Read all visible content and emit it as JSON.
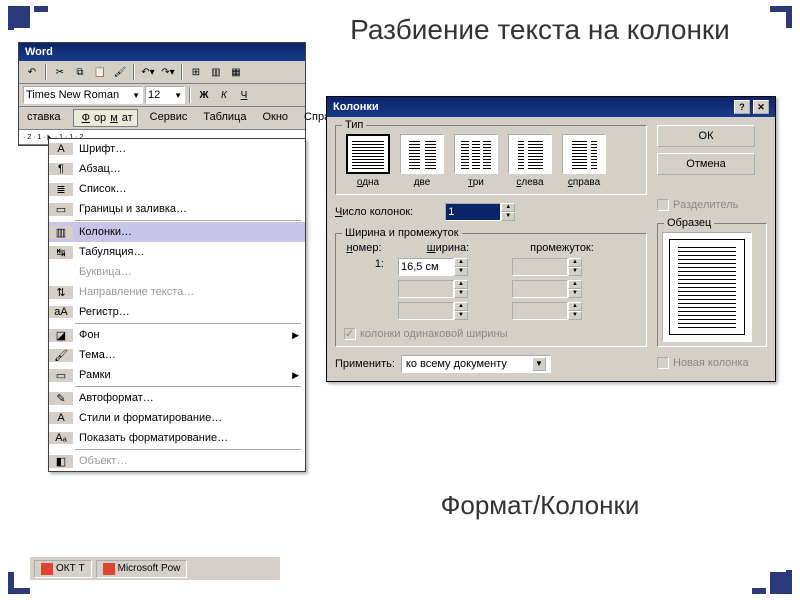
{
  "slide": {
    "title": "Разбиение текста на колонки",
    "subtitle": "Формат/Колонки"
  },
  "word": {
    "title": "Word",
    "font_name": "Times New Roman",
    "font_size": "12",
    "bold": "Ж",
    "italic": "К",
    "underline": "Ч",
    "menus": {
      "vstavka": "ставка",
      "format": "Формат",
      "servis": "Сервис",
      "tablica": "Таблица",
      "okno": "Окно",
      "spravka": "Справн"
    },
    "dropdown": [
      {
        "icon": "A",
        "label": "Шрифт…"
      },
      {
        "icon": "¶",
        "label": "Абзац…"
      },
      {
        "icon": "≣",
        "label": "Список…"
      },
      {
        "icon": "▭",
        "label": "Границы и заливка…"
      },
      {
        "sep": true
      },
      {
        "icon": "▥",
        "label": "Колонки…",
        "selected": true
      },
      {
        "icon": "↹",
        "label": "Табуляция…"
      },
      {
        "icon": "",
        "label": "Буквица…",
        "disabled": true
      },
      {
        "icon": "⇅",
        "label": "Направление текста…",
        "disabled": true
      },
      {
        "icon": "aA",
        "label": "Регистр…"
      },
      {
        "sep": true
      },
      {
        "icon": "◪",
        "label": "Фон",
        "sub": true
      },
      {
        "icon": "🖌",
        "label": "Тема…"
      },
      {
        "icon": "▭",
        "label": "Рамки",
        "sub": true
      },
      {
        "sep": true
      },
      {
        "icon": "✎",
        "label": "Автоформат…"
      },
      {
        "icon": "A",
        "label": "Стили и форматирование…"
      },
      {
        "icon": "Aₐ",
        "label": "Показать форматирование…"
      },
      {
        "sep": true
      },
      {
        "icon": "◧",
        "label": "Объект…",
        "disabled": true
      }
    ]
  },
  "dialog": {
    "title": "Колонки",
    "type_label": "Тип",
    "presets": [
      {
        "label": "одна",
        "type": "one",
        "selected": true
      },
      {
        "label": "две",
        "type": "two"
      },
      {
        "label": "три",
        "type": "three"
      },
      {
        "label": "слева",
        "type": "left"
      },
      {
        "label": "справа",
        "type": "right"
      }
    ],
    "ok": "ОК",
    "cancel": "Отмена",
    "num_cols_label": "Число колонок:",
    "num_cols_value": "1",
    "separator_label": "Разделитель",
    "width_gap_label": "Ширина и промежуток",
    "hdr_number": "номер:",
    "hdr_width": "ширина:",
    "hdr_gap": "промежуток:",
    "row1_num": "1:",
    "row1_width": "16,5 см",
    "equal_width": "колонки одинаковой ширины",
    "preview_label": "Образец",
    "apply_label": "Применить:",
    "apply_value": "ко всему документу",
    "new_col_label": "Новая колонка"
  },
  "taskbar": {
    "item1": "ОКТ Т",
    "item2": "Microsoft Pow"
  }
}
